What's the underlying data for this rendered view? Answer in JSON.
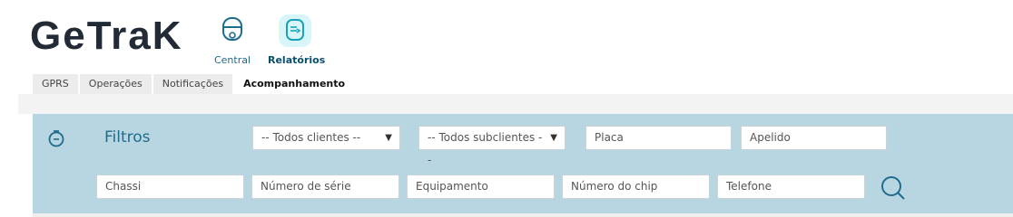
{
  "app": {
    "logo_text": "GeTraK",
    "nav": [
      {
        "label": "Central",
        "icon": "headset-icon"
      },
      {
        "label": "Relatórios",
        "icon": "report-icon"
      }
    ]
  },
  "tabs": [
    {
      "label": "GPRS",
      "active": false
    },
    {
      "label": "Operações",
      "active": false
    },
    {
      "label": "Notificações",
      "active": false
    },
    {
      "label": "Acompanhamento",
      "active": true
    }
  ],
  "filters": {
    "title": "Filtros",
    "clients_select": "-- Todos clientes --",
    "subclients_select": "-- Todos subclientes --",
    "placa_placeholder": "Placa",
    "apelido_placeholder": "Apelido",
    "chassi_placeholder": "Chassi",
    "serial_placeholder": "Número de série",
    "equip_placeholder": "Equipamento",
    "chip_placeholder": "Número do chip",
    "phone_placeholder": "Telefone",
    "search_icon": "search-icon"
  },
  "colors": {
    "accent": "#1f6d8c",
    "filter_bg": "#b8d6e2",
    "active_nav_bg": "#d8f6f9"
  }
}
